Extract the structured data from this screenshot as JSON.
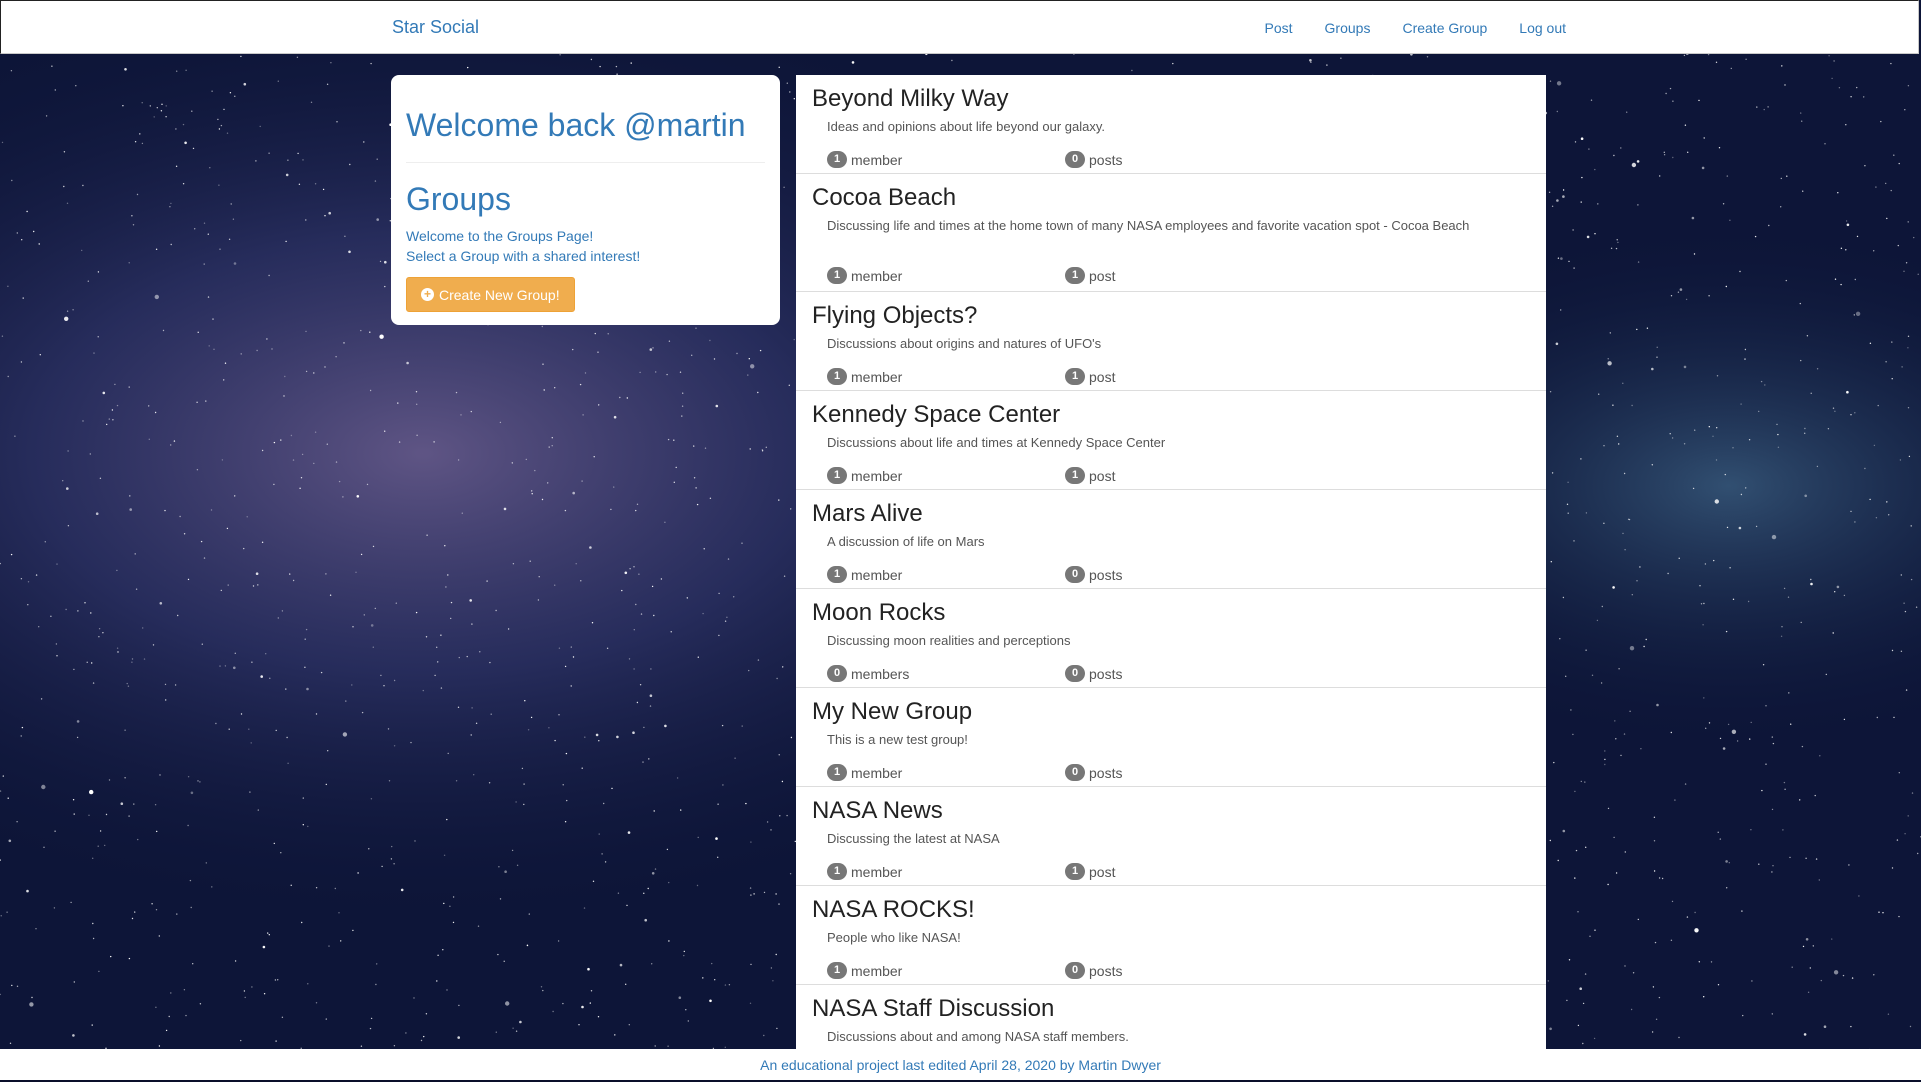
{
  "nav": {
    "brand": "Star Social",
    "links": [
      "Post",
      "Groups",
      "Create Group",
      "Log out"
    ]
  },
  "sidebar": {
    "welcome": "Welcome back @martin",
    "heading": "Groups",
    "intro_line1": "Welcome to the Groups Page!",
    "intro_line2": "Select a Group with a shared interest!",
    "create_button": "Create New Group!"
  },
  "groups": [
    {
      "name": "Beyond Milky Way",
      "description": "Ideas and opinions about life beyond our galaxy.",
      "members": "1",
      "members_label": "member",
      "posts": "0",
      "posts_label": "posts"
    },
    {
      "name": "Cocoa Beach",
      "description": "Discussing life and times at the home town of many NASA employees and favorite vacation spot - Cocoa Beach",
      "members": "1",
      "members_label": "member",
      "posts": "1",
      "posts_label": "post"
    },
    {
      "name": "Flying Objects?",
      "description": "Discussions about origins and natures of UFO's",
      "members": "1",
      "members_label": "member",
      "posts": "1",
      "posts_label": "post"
    },
    {
      "name": "Kennedy Space Center",
      "description": "Discussions about life and times at Kennedy Space Center",
      "members": "1",
      "members_label": "member",
      "posts": "1",
      "posts_label": "post"
    },
    {
      "name": "Mars Alive",
      "description": "A discussion of life on Mars",
      "members": "1",
      "members_label": "member",
      "posts": "0",
      "posts_label": "posts"
    },
    {
      "name": "Moon Rocks",
      "description": "Discussing moon realities and perceptions",
      "members": "0",
      "members_label": "members",
      "posts": "0",
      "posts_label": "posts"
    },
    {
      "name": "My New Group",
      "description": "This is a new test group!",
      "members": "1",
      "members_label": "member",
      "posts": "0",
      "posts_label": "posts"
    },
    {
      "name": "NASA News",
      "description": "Discussing the latest at NASA",
      "members": "1",
      "members_label": "member",
      "posts": "1",
      "posts_label": "post"
    },
    {
      "name": "NASA ROCKS!",
      "description": "People who like NASA!",
      "members": "1",
      "members_label": "member",
      "posts": "0",
      "posts_label": "posts"
    },
    {
      "name": "NASA Staff Discussion",
      "description": "Discussions about and among NASA staff members.",
      "members": "",
      "members_label": "",
      "posts": "",
      "posts_label": ""
    }
  ],
  "footer": "An educational project last edited April 28, 2020 by Martin Dwyer"
}
